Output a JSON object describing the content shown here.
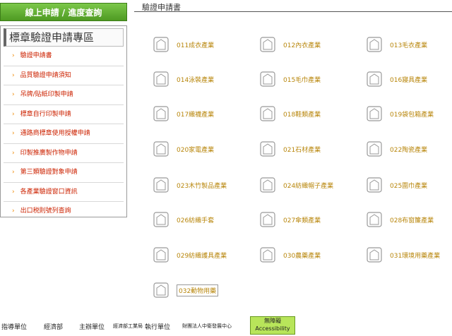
{
  "top_button": "線上申請 / 進度查詢",
  "page_title": "驗證申請書",
  "sidebar": {
    "title": "標章驗證申請專區",
    "items": [
      {
        "label": "驗證申請書"
      },
      {
        "label": "品質驗證申請須知"
      },
      {
        "label": "吊牌/貼紙印製申請"
      },
      {
        "label": "標章自行印製申請"
      },
      {
        "label": "通路商標章使用授權申請"
      },
      {
        "label": "印製推廣製作物申請"
      },
      {
        "label": "第三類驗證對象申請"
      },
      {
        "label": "各產業驗證窗口資訊"
      },
      {
        "label": "出口税則號列查詢"
      }
    ]
  },
  "categories": [
    {
      "label": "011成衣產業",
      "icon": "shirt-icon"
    },
    {
      "label": "012內衣產業",
      "icon": "underwear-icon"
    },
    {
      "label": "013毛衣產業",
      "icon": "sweater-icon"
    },
    {
      "label": "014泳裝產業",
      "icon": "swimsuit-icon"
    },
    {
      "label": "015毛巾產業",
      "icon": "towel-icon"
    },
    {
      "label": "016寢具產業",
      "icon": "bedding-icon"
    },
    {
      "label": "017織襪產業",
      "icon": "sock-icon"
    },
    {
      "label": "018鞋類產業",
      "icon": "shoe-icon"
    },
    {
      "label": "019袋包箱產業",
      "icon": "bag-icon"
    },
    {
      "label": "020家電產業",
      "icon": "appliance-icon"
    },
    {
      "label": "021石材產業",
      "icon": "stone-icon"
    },
    {
      "label": "022陶瓷產業",
      "icon": "ceramic-icon"
    },
    {
      "label": "023木竹製品產業",
      "icon": "bamboo-icon"
    },
    {
      "label": "024紡織帽子產業",
      "icon": "hat-icon"
    },
    {
      "label": "025圍巾產業",
      "icon": "scarf-icon"
    },
    {
      "label": "026紡織手套",
      "icon": "glove-icon"
    },
    {
      "label": "027傘類產業",
      "icon": "umbrella-icon"
    },
    {
      "label": "028布窗簾產業",
      "icon": "curtain-icon"
    },
    {
      "label": "029紡織護具產業",
      "icon": "protector-icon"
    },
    {
      "label": "030農藥產業",
      "icon": "pesticide-icon"
    },
    {
      "label": "031環境用藥產業",
      "icon": "env-medicine-icon"
    },
    {
      "label": "032動物用藥",
      "icon": "vet-medicine-icon"
    }
  ],
  "footer": {
    "guide_label": "指導單位",
    "guide_org": "經濟部",
    "host_label": "主辦單位",
    "host_org": "經濟部工業局",
    "exec_label": "執行單位",
    "exec_org": "財團法人中衛發展中心",
    "badge_text": "無障礙",
    "badge_sub": "Accessibility"
  }
}
